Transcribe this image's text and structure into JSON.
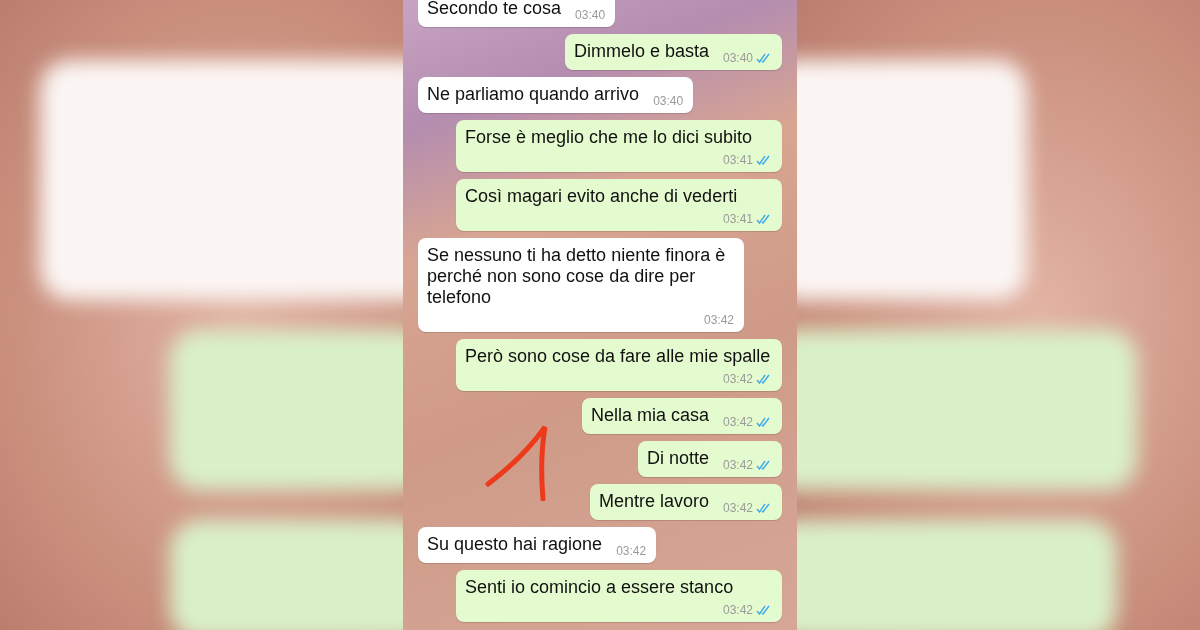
{
  "messages": [
    {
      "kind": "received",
      "text": "Secondo te cosa",
      "time": "03:40",
      "read": false
    },
    {
      "kind": "sent",
      "text": "Dimmelo e basta",
      "time": "03:40",
      "read": true
    },
    {
      "kind": "received",
      "text": "Ne parliamo quando arrivo",
      "time": "03:40",
      "read": false
    },
    {
      "kind": "sent",
      "text": "Forse è meglio che me lo dici subito",
      "time": "03:41",
      "read": true
    },
    {
      "kind": "sent",
      "text": "Così magari evito anche di vederti",
      "time": "03:41",
      "read": true
    },
    {
      "kind": "received",
      "text": "Se nessuno ti ha detto niente finora è perché non sono cose da dire per telefono",
      "time": "03:42",
      "read": false
    },
    {
      "kind": "sent",
      "text": "Però sono cose da fare alle mie spalle",
      "time": "03:42",
      "read": true
    },
    {
      "kind": "sent",
      "text": "Nella mia casa",
      "time": "03:42",
      "read": true
    },
    {
      "kind": "sent",
      "text": "Di notte",
      "time": "03:42",
      "read": true
    },
    {
      "kind": "sent",
      "text": "Mentre lavoro",
      "time": "03:42",
      "read": true
    },
    {
      "kind": "received",
      "text": "Su questo hai ragione",
      "time": "03:42",
      "read": false
    },
    {
      "kind": "sent",
      "text": "Senti io comincio a essere stanco",
      "time": "03:42",
      "read": true
    }
  ]
}
